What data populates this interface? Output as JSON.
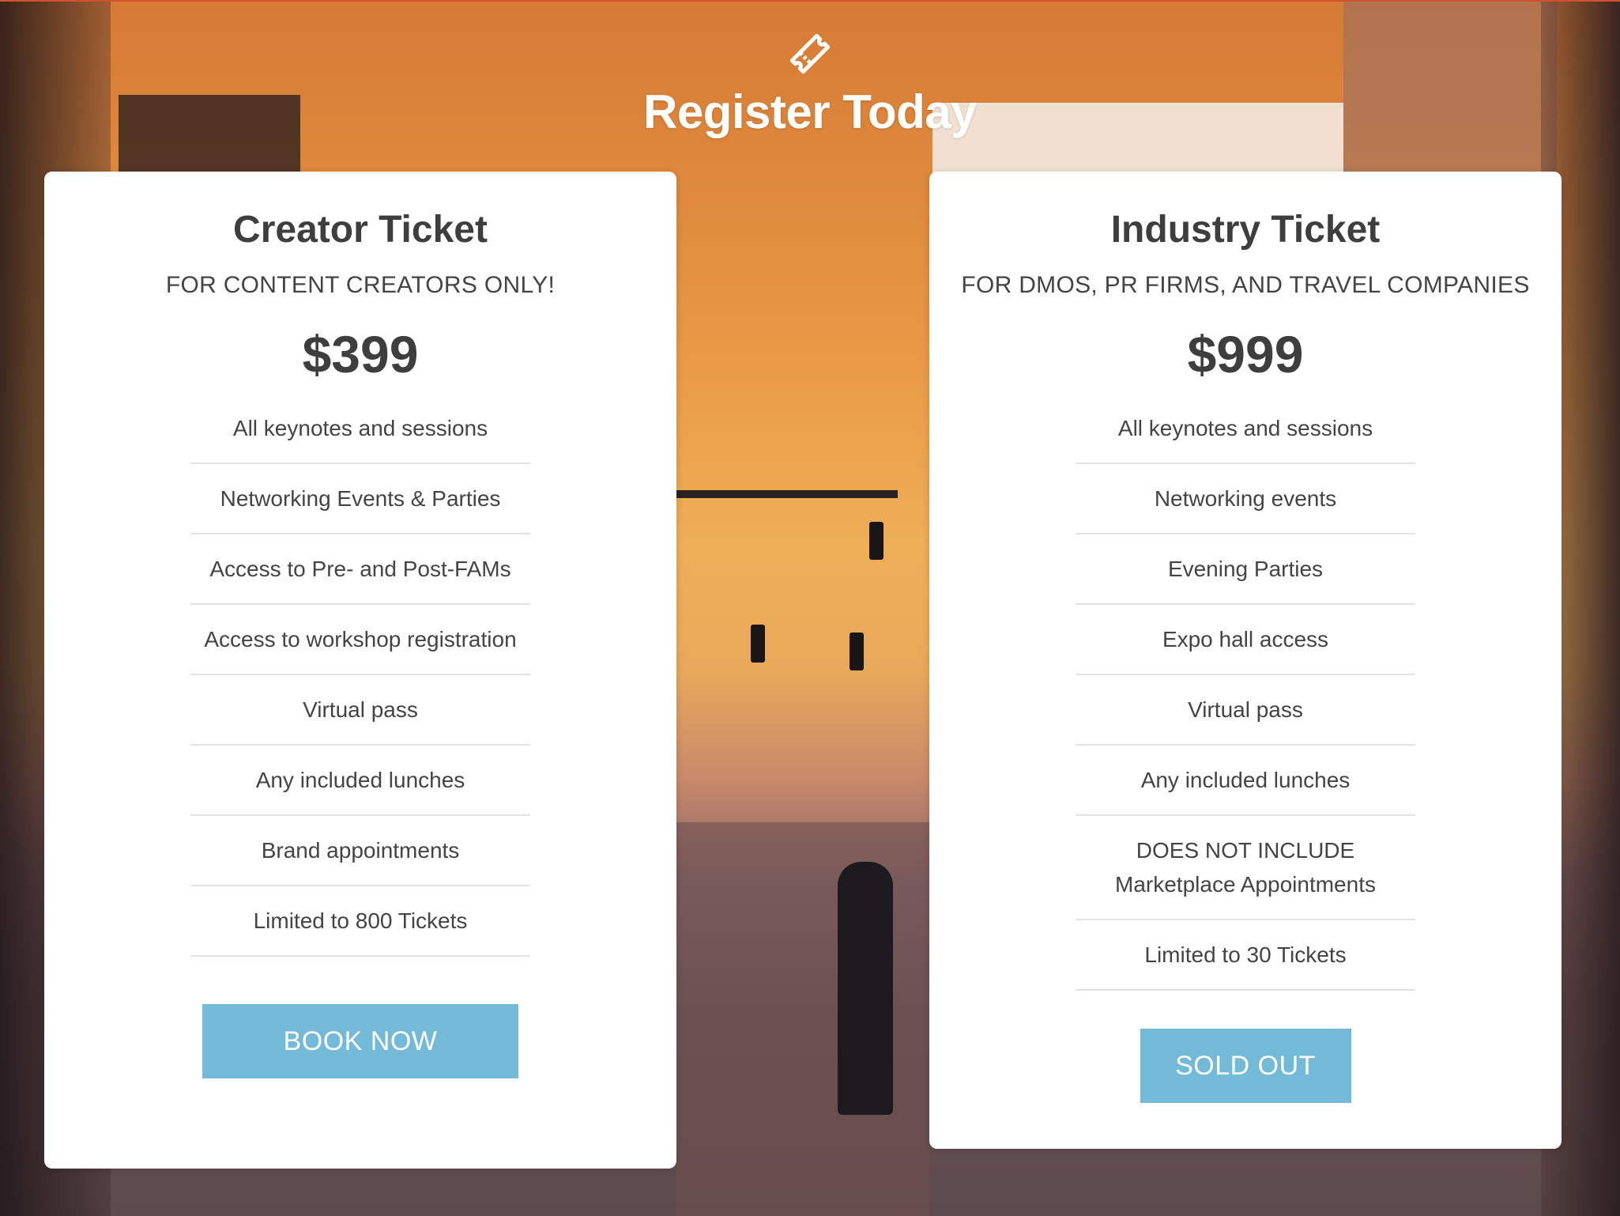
{
  "header": {
    "icon": "ticket-icon",
    "title": "Register Today"
  },
  "colors": {
    "accent_button": "#73bad8",
    "top_bar": "#d0532d",
    "text_dark": "#3e3e3e"
  },
  "tickets": [
    {
      "name": "Creator Ticket",
      "subtitle": "FOR CONTENT CREATORS ONLY!",
      "price": "$399",
      "features": [
        "All keynotes and sessions",
        "Networking Events & Parties",
        "Access to Pre- and Post-FAMs",
        "Access to workshop registration",
        "Virtual pass",
        "Any included lunches",
        "Brand appointments",
        "Limited to 800 Tickets"
      ],
      "button": "BOOK NOW"
    },
    {
      "name": "Industry Ticket",
      "subtitle": "FOR DMOS, PR FIRMS, AND TRAVEL COMPANIES",
      "price": "$999",
      "features": [
        "All keynotes and sessions",
        "Networking events",
        "Evening Parties",
        "Expo hall access",
        "Virtual pass",
        "Any included lunches",
        "DOES NOT INCLUDE Marketplace Appointments",
        "Limited to 30 Tickets"
      ],
      "button": "SOLD OUT"
    }
  ]
}
